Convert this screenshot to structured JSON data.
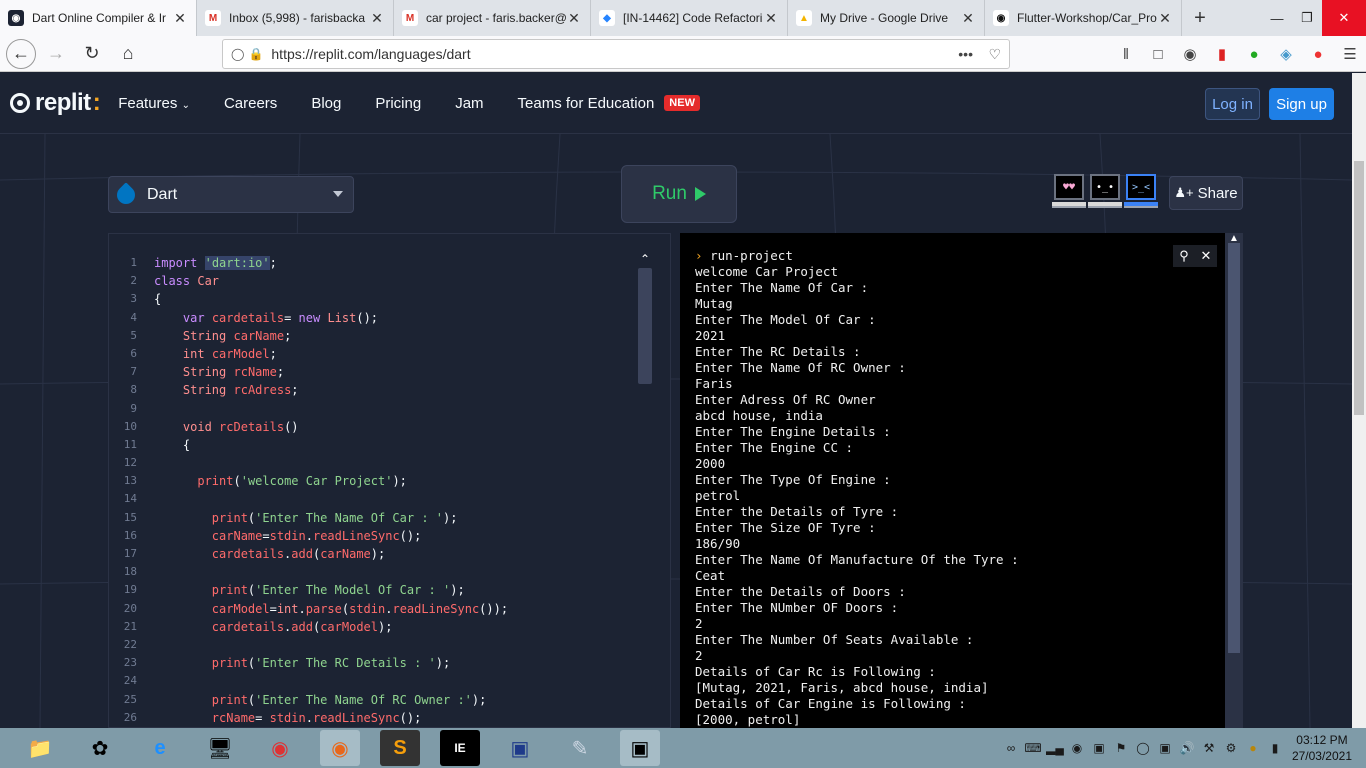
{
  "browser": {
    "tabs": [
      {
        "label": "Dart Online Compiler & Ir",
        "icon": "replit-icon",
        "active": true
      },
      {
        "label": "Inbox (5,998) - farisbacka",
        "icon": "gmail-icon",
        "active": false
      },
      {
        "label": "car project - faris.backer@",
        "icon": "gmail-icon",
        "active": false
      },
      {
        "label": "[IN-14462] Code Refactori",
        "icon": "jira-icon",
        "active": false
      },
      {
        "label": "My Drive - Google Drive",
        "icon": "drive-icon",
        "active": false
      },
      {
        "label": "Flutter-Workshop/Car_Pro",
        "icon": "github-icon",
        "active": false
      }
    ],
    "url": "https://replit.com/languages/dart"
  },
  "header": {
    "logo": "replit",
    "menu": [
      "Features",
      "Careers",
      "Blog",
      "Pricing",
      "Jam",
      "Teams for Education"
    ],
    "new_badge": "NEW",
    "login": "Log in",
    "signup": "Sign up"
  },
  "toolbar": {
    "language": "Dart",
    "run": "Run",
    "share": "Share"
  },
  "editor": {
    "lines": [
      {
        "n": "1",
        "html": "<span class='kw'>import</span> <span class='str hl'>'dart:io'</span>;"
      },
      {
        "n": "2",
        "html": "<span class='kw'>class</span> <span class='ty'>Car</span>"
      },
      {
        "n": "3",
        "html": "{"
      },
      {
        "n": "4",
        "html": "    <span class='kw'>var</span> <span class='fn'>cardetails</span>= <span class='kw'>new</span> <span class='ty'>List</span>();"
      },
      {
        "n": "5",
        "html": "    <span class='ty'>String</span> <span class='fn'>carName</span>;"
      },
      {
        "n": "6",
        "html": "    <span class='ty'>int</span> <span class='fn'>carModel</span>;"
      },
      {
        "n": "7",
        "html": "    <span class='ty'>String</span> <span class='fn'>rcName</span>;"
      },
      {
        "n": "8",
        "html": "    <span class='ty'>String</span> <span class='fn'>rcAdress</span>;"
      },
      {
        "n": "9",
        "html": ""
      },
      {
        "n": "10",
        "html": "    <span class='ty'>void</span> <span class='fn'>rcDetails</span>()"
      },
      {
        "n": "11",
        "html": "    {"
      },
      {
        "n": "12",
        "html": ""
      },
      {
        "n": "13",
        "html": "      <span class='fn'>print</span>(<span class='str'>'welcome Car Project'</span>);"
      },
      {
        "n": "14",
        "html": ""
      },
      {
        "n": "15",
        "html": "        <span class='fn'>print</span>(<span class='str'>'Enter The Name Of Car : '</span>);"
      },
      {
        "n": "16",
        "html": "        <span class='fn'>carName</span>=<span class='fn'>stdin</span>.<span class='fn'>readLineSync</span>();"
      },
      {
        "n": "17",
        "html": "        <span class='fn'>cardetails</span>.<span class='fn'>add</span>(<span class='fn'>carName</span>);"
      },
      {
        "n": "18",
        "html": ""
      },
      {
        "n": "19",
        "html": "        <span class='fn'>print</span>(<span class='str'>'Enter The Model Of Car : '</span>);"
      },
      {
        "n": "20",
        "html": "        <span class='fn'>carModel</span>=<span class='ty'>int</span>.<span class='fn'>parse</span>(<span class='fn'>stdin</span>.<span class='fn'>readLineSync</span>());"
      },
      {
        "n": "21",
        "html": "        <span class='fn'>cardetails</span>.<span class='fn'>add</span>(<span class='fn'>carModel</span>);"
      },
      {
        "n": "22",
        "html": ""
      },
      {
        "n": "23",
        "html": "        <span class='fn'>print</span>(<span class='str'>'Enter The RC Details : '</span>);"
      },
      {
        "n": "24",
        "html": ""
      },
      {
        "n": "25",
        "html": "        <span class='fn'>print</span>(<span class='str'>'Enter The Name Of RC Owner :'</span>);"
      },
      {
        "n": "26",
        "html": "        <span class='fn'>rcName</span>= <span class='fn'>stdin</span>.<span class='fn'>readLineSync</span>();"
      }
    ]
  },
  "console": {
    "prompt": "run-project",
    "lines": [
      "welcome Car Project",
      "Enter The Name Of Car :",
      "Mutag",
      "Enter The Model Of Car :",
      "2021",
      "Enter The RC Details :",
      "Enter The Name Of RC Owner :",
      "Faris",
      "Enter Adress Of RC Owner",
      "abcd house, india",
      "Enter The Engine Details :",
      "Enter The Engine CC :",
      "2000",
      "Enter The Type Of Engine :",
      "petrol",
      "Enter the Details of Tyre :",
      "Enter The Size OF Tyre :",
      "186/90",
      "Enter The Name Of Manufacture Of the Tyre :",
      "Ceat",
      "Enter the Details of Doors :",
      "Enter The NUmber OF Doors :",
      "2",
      "Enter The Number Of Seats Available :",
      "2",
      "Details of Car Rc is Following :",
      "[Mutag, 2021, Faris, abcd house, india]",
      "Details of Car Engine is Following :",
      "[2000, petrol]"
    ]
  },
  "taskbar": {
    "time": "03:12 PM",
    "date": "27/03/2021"
  },
  "colors": {
    "bg": "#1c2333",
    "run_green": "#2fca69",
    "signup_blue": "#1e7fe6",
    "new_badge": "#e52b2b"
  }
}
